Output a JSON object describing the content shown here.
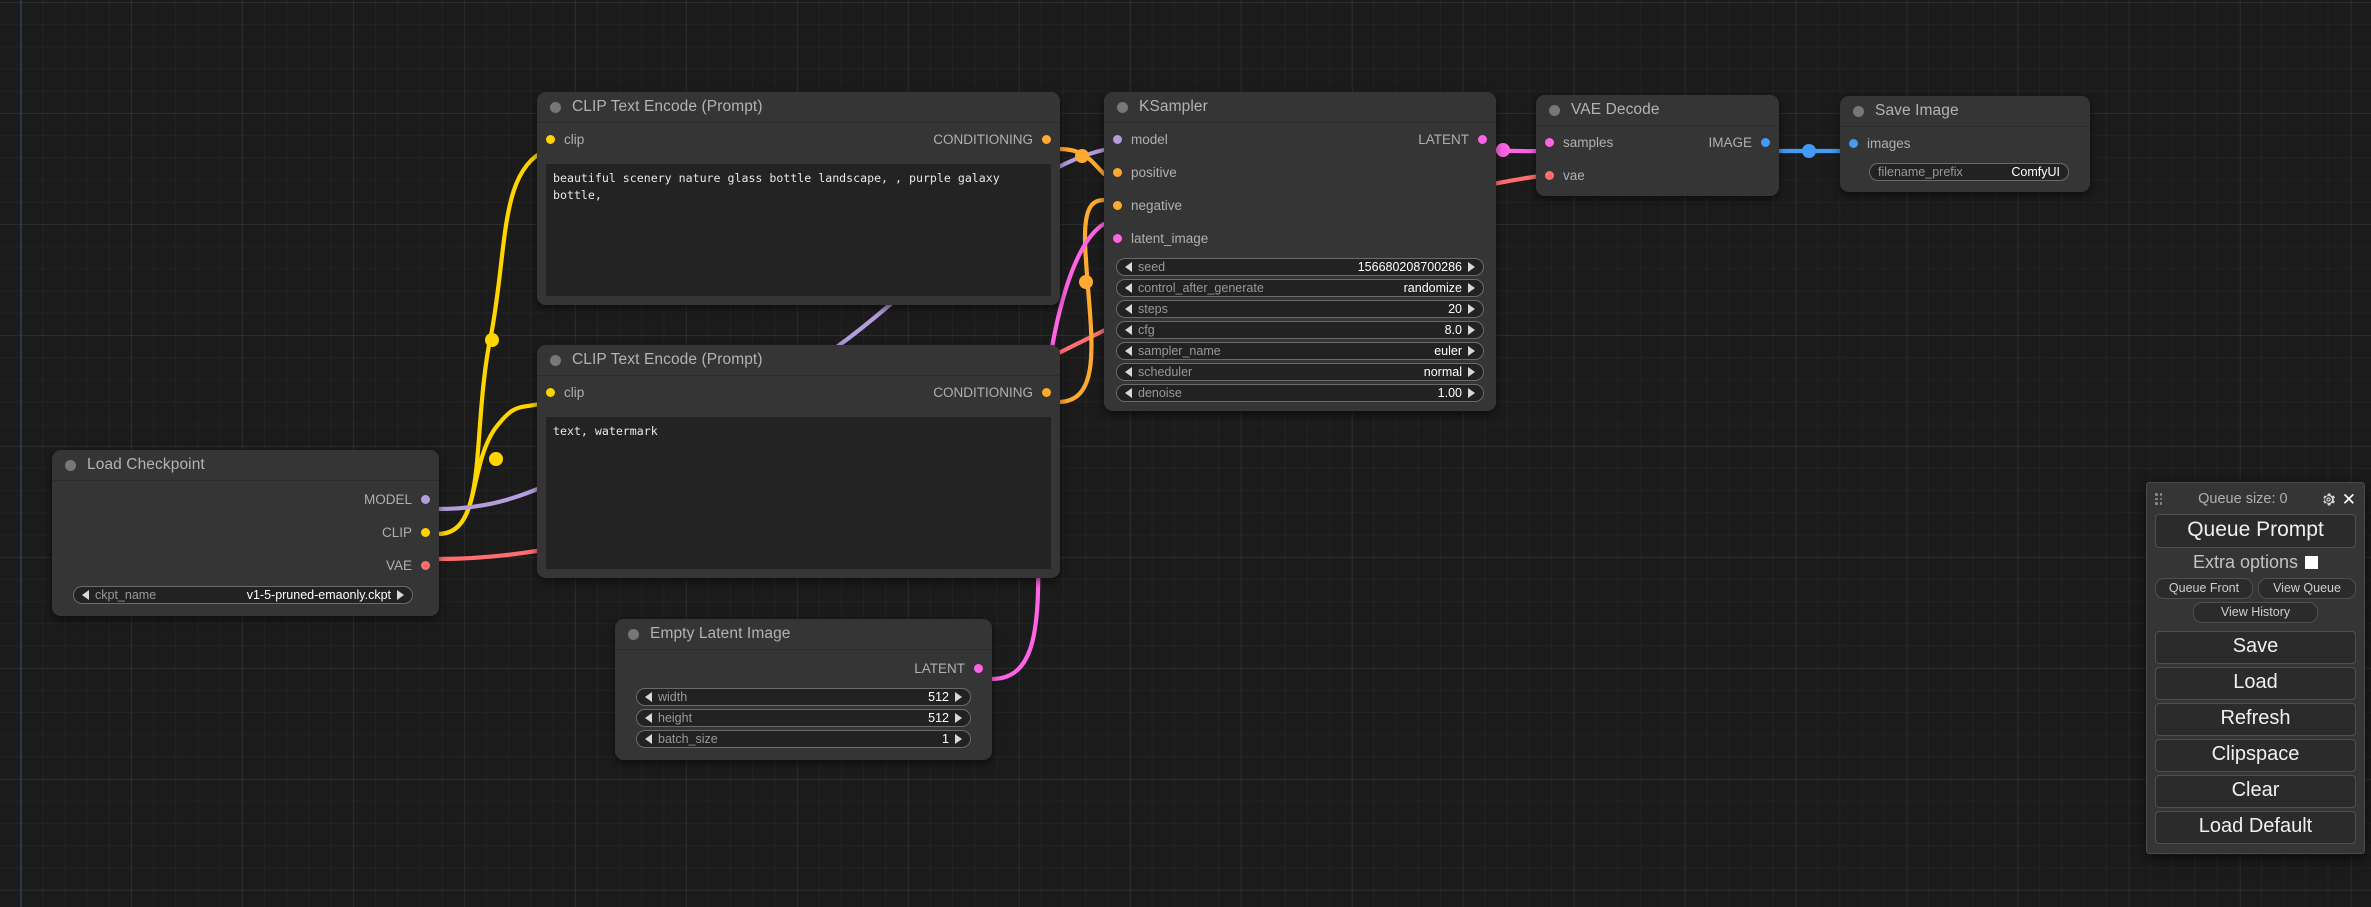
{
  "app": {
    "name": "ComfyUI",
    "canvas_background": "#1b1b1b"
  },
  "nodes": [
    {
      "id": "load-checkpoint",
      "title": "Load Checkpoint",
      "outputs": [
        {
          "label": "MODEL",
          "type": "MODEL",
          "color": "#B39DDB"
        },
        {
          "label": "CLIP",
          "type": "CLIP",
          "color": "#FFD500"
        },
        {
          "label": "VAE",
          "type": "VAE",
          "color": "#FF6E6E"
        }
      ],
      "widgets": [
        {
          "label": "ckpt_name",
          "value": "v1-5-pruned-emaonly.ckpt"
        }
      ]
    },
    {
      "id": "clip-text-encode-positive",
      "title": "CLIP Text Encode (Prompt)",
      "inputs": [
        {
          "label": "clip",
          "type": "CLIP",
          "color": "#FFD500"
        }
      ],
      "outputs": [
        {
          "label": "CONDITIONING",
          "type": "CONDITIONING",
          "color": "#FFA931"
        }
      ],
      "text": "beautiful scenery nature glass bottle landscape, , purple galaxy bottle,"
    },
    {
      "id": "clip-text-encode-negative",
      "title": "CLIP Text Encode (Prompt)",
      "inputs": [
        {
          "label": "clip",
          "type": "CLIP",
          "color": "#FFD500"
        }
      ],
      "outputs": [
        {
          "label": "CONDITIONING",
          "type": "CONDITIONING",
          "color": "#FFA931"
        }
      ],
      "text": "text, watermark"
    },
    {
      "id": "empty-latent-image",
      "title": "Empty Latent Image",
      "outputs": [
        {
          "label": "LATENT",
          "type": "LATENT",
          "color": "#FF64E4"
        }
      ],
      "widgets": [
        {
          "label": "width",
          "value": "512"
        },
        {
          "label": "height",
          "value": "512"
        },
        {
          "label": "batch_size",
          "value": "1"
        }
      ]
    },
    {
      "id": "ksampler",
      "title": "KSampler",
      "inputs": [
        {
          "label": "model",
          "type": "MODEL",
          "color": "#B39DDB"
        },
        {
          "label": "positive",
          "type": "CONDITIONING",
          "color": "#FFA931"
        },
        {
          "label": "negative",
          "type": "CONDITIONING",
          "color": "#FFA931"
        },
        {
          "label": "latent_image",
          "type": "LATENT",
          "color": "#FF64E4"
        }
      ],
      "outputs": [
        {
          "label": "LATENT",
          "type": "LATENT",
          "color": "#FF64E4"
        }
      ],
      "widgets": [
        {
          "label": "seed",
          "value": "156680208700286"
        },
        {
          "label": "control_after_generate",
          "value": "randomize"
        },
        {
          "label": "steps",
          "value": "20"
        },
        {
          "label": "cfg",
          "value": "8.0"
        },
        {
          "label": "sampler_name",
          "value": "euler"
        },
        {
          "label": "scheduler",
          "value": "normal"
        },
        {
          "label": "denoise",
          "value": "1.00"
        }
      ]
    },
    {
      "id": "vae-decode",
      "title": "VAE Decode",
      "inputs": [
        {
          "label": "samples",
          "type": "LATENT",
          "color": "#FF64E4"
        },
        {
          "label": "vae",
          "type": "VAE",
          "color": "#FF6E6E"
        }
      ],
      "outputs": [
        {
          "label": "IMAGE",
          "type": "IMAGE",
          "color": "#429bf5"
        }
      ]
    },
    {
      "id": "save-image",
      "title": "Save Image",
      "inputs": [
        {
          "label": "images",
          "type": "IMAGE",
          "color": "#429bf5"
        }
      ],
      "widgets": [
        {
          "label": "filename_prefix",
          "value": "ComfyUI"
        }
      ]
    }
  ],
  "menu": {
    "queue_size_label": "Queue size: 0",
    "gear_icon": "gear-icon",
    "close_icon": "close-icon",
    "queue_prompt": "Queue Prompt",
    "extra_options": "Extra options",
    "queue_front": "Queue Front",
    "view_queue": "View Queue",
    "view_history": "View History",
    "save": "Save",
    "load": "Load",
    "refresh": "Refresh",
    "clipspace": "Clipspace",
    "clear": "Clear",
    "load_default": "Load Default"
  }
}
